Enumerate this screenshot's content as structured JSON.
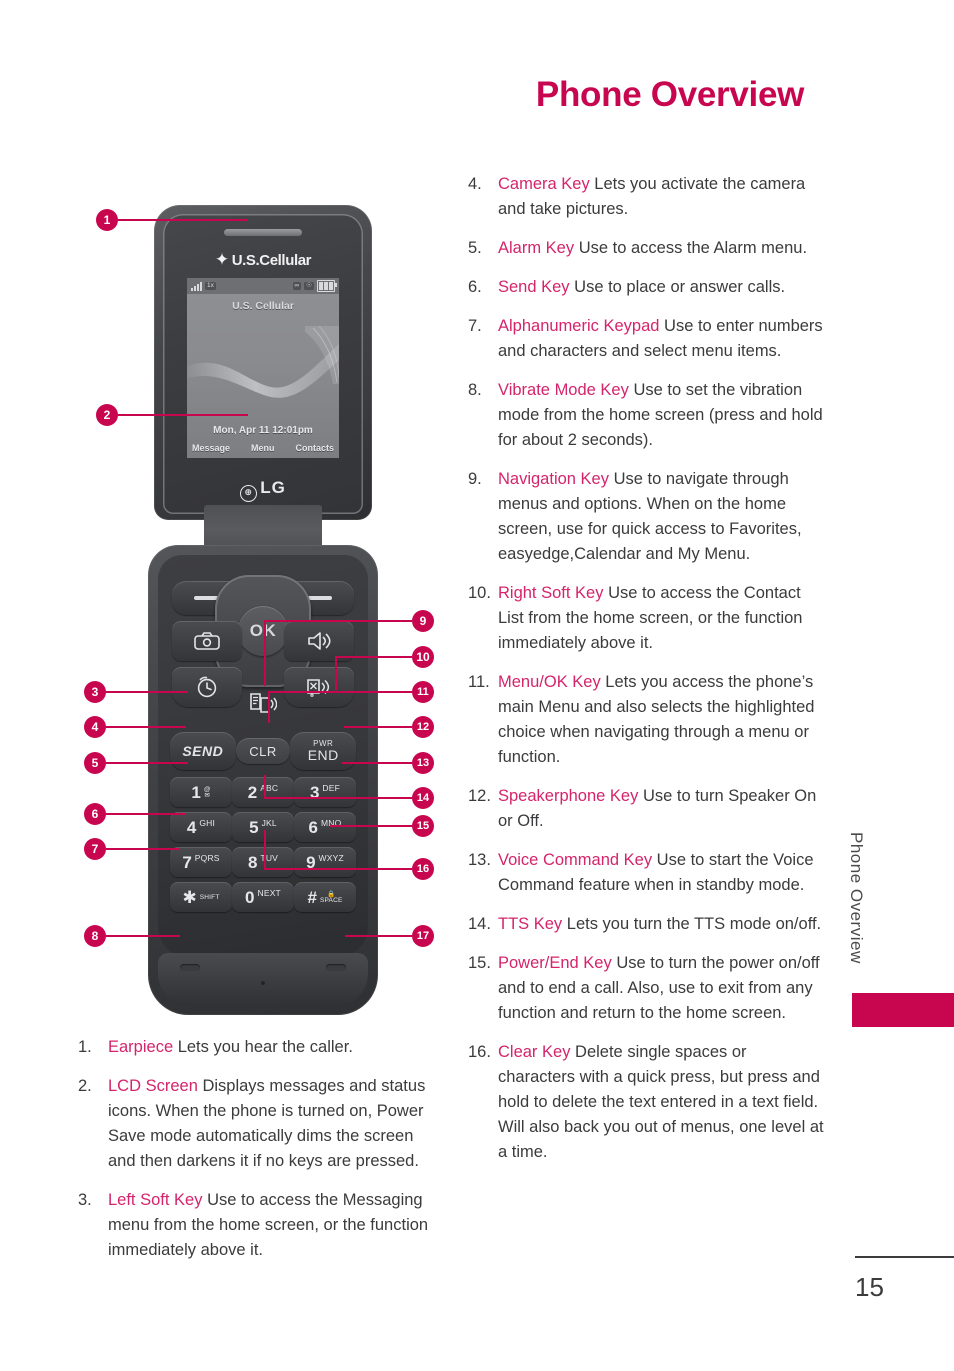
{
  "header": {
    "title": "Phone Overview"
  },
  "side": {
    "running_head": "Phone Overview",
    "page_number": "15"
  },
  "phone": {
    "carrier_brand": "U.S.Cellular",
    "maker_brand": "LG",
    "lcd": {
      "carrier": "U.S. Cellular",
      "datetime": "Mon, Apr 11  12:01pm",
      "soft_left": "Message",
      "soft_center": "Menu",
      "soft_right": "Contacts",
      "status_1x": "1x"
    },
    "keys": {
      "ok": "OK",
      "send": "SEND",
      "clr": "CLR",
      "pwr": "PWR",
      "end": "END",
      "numbers": [
        [
          {
            "digit": "1",
            "sub": "@"
          },
          {
            "digit": "2",
            "sub": "ABC"
          },
          {
            "digit": "3",
            "sub": "DEF"
          }
        ],
        [
          {
            "digit": "4",
            "sub": "GHI"
          },
          {
            "digit": "5",
            "sub": "JKL"
          },
          {
            "digit": "6",
            "sub": "MNO"
          }
        ],
        [
          {
            "digit": "7",
            "sub": "PQRS"
          },
          {
            "digit": "8",
            "sub": "TUV"
          },
          {
            "digit": "9",
            "sub": "WXYZ"
          }
        ],
        [
          {
            "digit": "✱",
            "sub": "SHIFT"
          },
          {
            "digit": "0",
            "sub": "NEXT"
          },
          {
            "digit": "#",
            "sub": "SPACE"
          }
        ]
      ]
    }
  },
  "callouts": [
    "1",
    "2",
    "3",
    "4",
    "5",
    "6",
    "7",
    "8",
    "9",
    "10",
    "11",
    "12",
    "13",
    "14",
    "15",
    "16",
    "17"
  ],
  "left_items": [
    {
      "num": "1.",
      "term": "Earpiece",
      "desc": " Lets you hear the caller."
    },
    {
      "num": "2.",
      "term": "LCD Screen",
      "desc": " Displays messages and status icons. When the phone is turned on, Power Save mode automatically dims the screen and then darkens it if no keys are pressed."
    },
    {
      "num": "3.",
      "term": "Left Soft Key",
      "desc": " Use to access the Messaging menu from the home screen, or the function immediately above it."
    }
  ],
  "right_items": [
    {
      "num": "4.",
      "term": "Camera Key",
      "desc": " Lets you activate the camera and take pictures."
    },
    {
      "num": "5.",
      "term": "Alarm Key",
      "desc": " Use to access the Alarm menu."
    },
    {
      "num": "6.",
      "term": "Send Key",
      "desc": " Use to place or answer calls."
    },
    {
      "num": "7.",
      "term": "Alphanumeric Keypad",
      "desc": " Use to enter numbers and characters and select menu items."
    },
    {
      "num": "8.",
      "term": "Vibrate Mode Key",
      "desc": " Use to set the vibration mode from the home screen (press and hold for about 2 seconds)."
    },
    {
      "num": "9.",
      "term": "Navigation Key",
      "desc": " Use to navigate through menus and options. When on the home screen, use for quick access to Favorites, easyedge,Calendar and My Menu."
    },
    {
      "num": "10.",
      "term": "Right Soft Key",
      "desc": " Use to access the Contact List from the home screen, or the function immediately above it."
    },
    {
      "num": "11.",
      "term": "Menu/OK Key",
      "desc": " Lets you access the phone’s main Menu and also selects the highlighted choice when navigating through a menu or function."
    },
    {
      "num": "12.",
      "term": "Speakerphone Key",
      "desc": " Use to turn Speaker On or Off."
    },
    {
      "num": "13.",
      "term": "Voice Command Key",
      "desc": " Use to start the Voice Command feature when in standby mode."
    },
    {
      "num": "14.",
      "term": "TTS Key",
      "desc": " Lets you turn the TTS mode on/off."
    },
    {
      "num": "15.",
      "term": "Power/End Key",
      "desc": " Use to turn the power on/off and to end a call. Also, use to exit from any function and return to the home screen."
    },
    {
      "num": "16.",
      "term": "Clear Key",
      "desc": " Delete single spaces or characters with a quick press, but press and hold to delete the text entered in a text field. Will also back you out of menus, one level at a time."
    }
  ],
  "colors": {
    "accent": "#c8064f",
    "term": "#d5246b",
    "text": "#3b3b3d"
  }
}
